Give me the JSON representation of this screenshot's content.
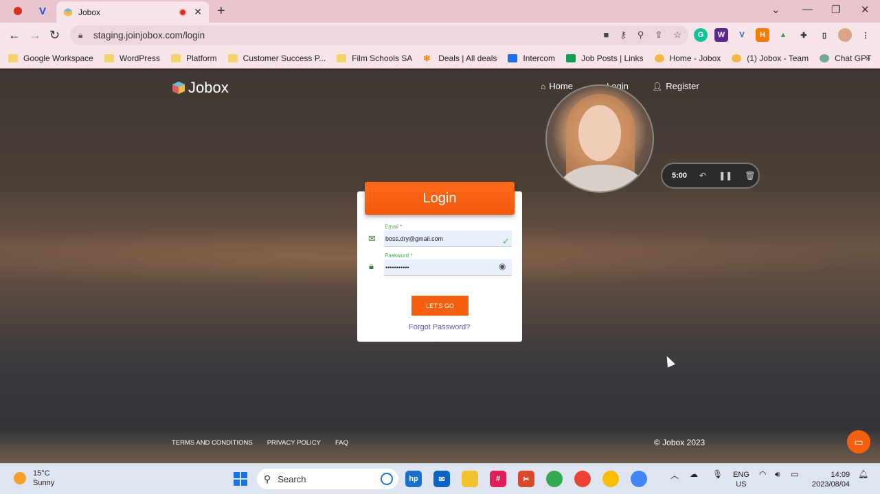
{
  "browser": {
    "tab_title": "Jobox",
    "url": "staging.joinjobox.com/login",
    "bookmarks": [
      {
        "label": "Google Workspace",
        "icon": "folder-icon"
      },
      {
        "label": "WordPress",
        "icon": "folder-icon"
      },
      {
        "label": "Platform",
        "icon": "folder-icon"
      },
      {
        "label": "Customer Success P...",
        "icon": "folder-icon"
      },
      {
        "label": "Film Schools SA",
        "icon": "folder-icon"
      },
      {
        "label": "Deals | All deals",
        "icon": "hubspot-icon"
      },
      {
        "label": "Intercom",
        "icon": "intercom-icon"
      },
      {
        "label": "Job Posts | Links",
        "icon": "sheets-icon"
      },
      {
        "label": "Home - Jobox",
        "icon": "jobox-icon"
      },
      {
        "label": "(1) Jobox - Team",
        "icon": "jobox-icon"
      },
      {
        "label": "Chat GPT",
        "icon": "chatgpt-icon"
      }
    ]
  },
  "site": {
    "logo_text": "Jobox",
    "nav": {
      "home": "Home",
      "login": "Login",
      "register": "Register"
    }
  },
  "recorder": {
    "time": "5:00"
  },
  "login": {
    "title": "Login",
    "email_label": "Email *",
    "email_value": "boss.dry@gmail.com",
    "password_label": "Password *",
    "password_value": "•••••••••••",
    "submit": "LET'S GO",
    "forgot": "Forgot Password?"
  },
  "footer": {
    "terms": "TERMS AND CONDITIONS",
    "privacy": "PRIVACY POLICY",
    "faq": "FAQ",
    "copyright": "© Jobox 2023"
  },
  "taskbar": {
    "weather_temp": "15°C",
    "weather_desc": "Sunny",
    "search": "Search",
    "lang": "ENG",
    "region": "US",
    "time": "14:09",
    "date": "2023/08/04"
  },
  "colors": {
    "accent": "#f4600f",
    "tab_bar": "#e8c5cd",
    "link": "#5b5bb5"
  }
}
